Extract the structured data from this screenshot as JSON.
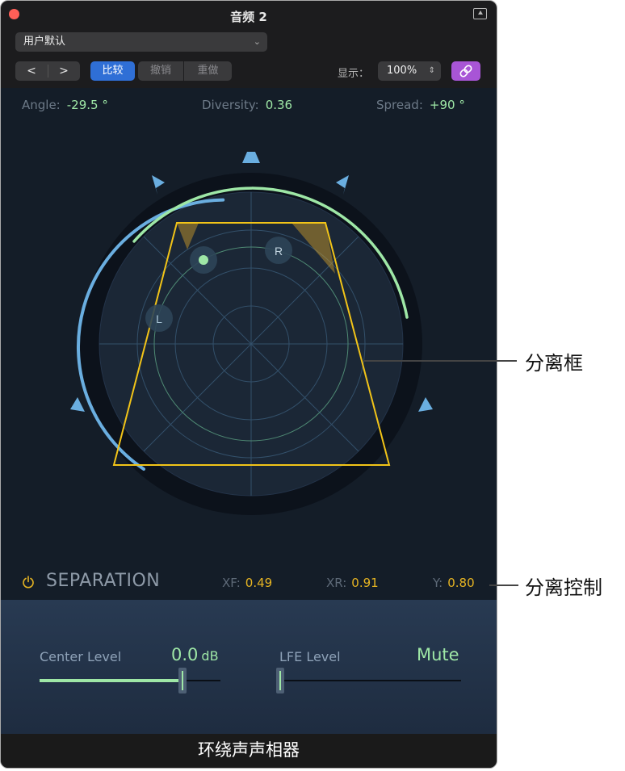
{
  "window": {
    "title": "音频 2"
  },
  "preset": {
    "value": "用户默认"
  },
  "toolbar": {
    "back": "<",
    "forward": ">",
    "compare": "比较",
    "undo": "撤销",
    "redo": "重做",
    "display_label": "显示：",
    "zoom": "100%"
  },
  "readouts": {
    "angle": {
      "label": "Angle:",
      "value": "-29.5 °"
    },
    "diversity": {
      "label": "Diversity:",
      "value": "0.36"
    },
    "spread": {
      "label": "Spread:",
      "value": "+90 °"
    }
  },
  "panner": {
    "left_label": "L",
    "right_label": "R"
  },
  "separation": {
    "title": "SEPARATION",
    "xf": {
      "label": "XF:",
      "value": "0.49"
    },
    "xr": {
      "label": "XR:",
      "value": "0.91"
    },
    "y": {
      "label": "Y:",
      "value": "0.80"
    }
  },
  "levels": {
    "center": {
      "label": "Center Level",
      "value": "0.0",
      "unit": "dB",
      "fill": 0.8
    },
    "lfe": {
      "label": "LFE Level",
      "value": "Mute",
      "fill": 0.0
    }
  },
  "footer": "环绕声声相器",
  "callouts": {
    "separation_box": "分离框",
    "separation_controls": "分离控制"
  },
  "colors": {
    "accent_green": "#9ee7a6",
    "accent_yellow": "#e6b422",
    "accent_blue": "#2f6fd6",
    "link_purple": "#a855d6",
    "speaker_blue": "#6aaee0"
  }
}
